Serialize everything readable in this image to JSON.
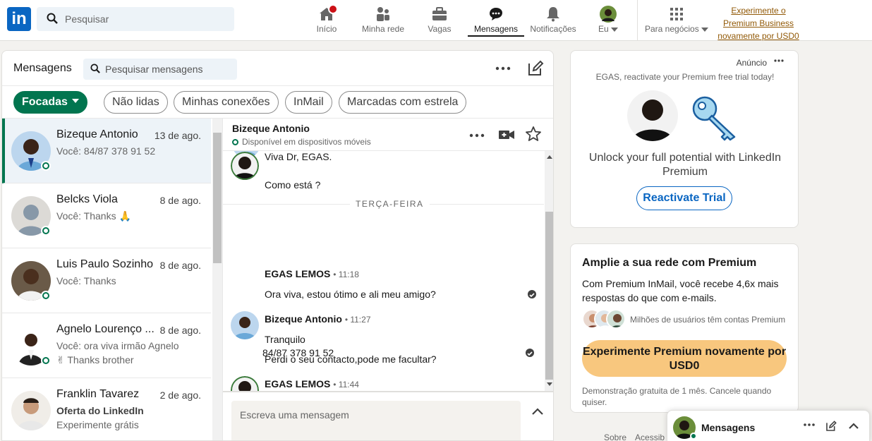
{
  "nav": {
    "logo": "in",
    "search_placeholder": "Pesquisar",
    "items": [
      {
        "label": "Início",
        "icon": "home-icon"
      },
      {
        "label": "Minha rede",
        "icon": "network-icon"
      },
      {
        "label": "Vagas",
        "icon": "briefcase-icon"
      },
      {
        "label": "Mensagens",
        "icon": "messaging-icon",
        "active": true
      },
      {
        "label": "Notificações",
        "icon": "bell-icon"
      },
      {
        "label": "Eu",
        "icon": "me-avatar"
      },
      {
        "label": "Para negócios",
        "icon": "grid-icon"
      }
    ],
    "premium_link": "Experimente o Premium Business novamente por USD0"
  },
  "messaging": {
    "title": "Mensagens",
    "search_placeholder": "Pesquisar mensagens",
    "filters": [
      "Focadas",
      "Não lidas",
      "Minhas conexões",
      "InMail",
      "Marcadas com estrela"
    ],
    "conversations": [
      {
        "name": "Bizeque Antonio",
        "date": "13 de ago.",
        "snippet": "Você: 84/87 378 91 52",
        "snippet2": ""
      },
      {
        "name": "Belcks Viola",
        "date": "8 de ago.",
        "snippet": "Você: Thanks 🙏",
        "snippet2": ""
      },
      {
        "name": "Luis Paulo Sozinho",
        "date": "8 de ago.",
        "snippet": "Você: Thanks",
        "snippet2": ""
      },
      {
        "name": "Agnelo Lourenço ...",
        "date": "8 de ago.",
        "snippet": "Você: ora viva irmão Agnelo",
        "snippet2": "✌ Thanks brother"
      },
      {
        "name": "Franklin Tavarez",
        "date": "2 de ago.",
        "snippet": "Oferta do LinkedIn",
        "snippet2": "Experimente grátis"
      }
    ]
  },
  "thread": {
    "name": "Bizeque Antonio",
    "status": "Disponível em dispositivos móveis",
    "prev_lines": [
      "Viva Dr, EGAS.",
      "Como está ?"
    ],
    "day_divider": "TERÇA-FEIRA",
    "messages": [
      {
        "sender": "EGAS LEMOS",
        "time": "• 11:18",
        "lines": [
          "Ora viva, estou ótimo e ali meu amigo?"
        ]
      },
      {
        "sender": "Bizeque Antonio",
        "time": "• 11:27",
        "lines": [
          "Tranquilo",
          "Perdi o seu contacto,pode me facultar?"
        ]
      },
      {
        "sender": "EGAS LEMOS",
        "time": "• 11:44",
        "lines": [
          "84/87 378 91 52"
        ]
      }
    ],
    "compose_placeholder": "Escreva uma mensagem"
  },
  "ad": {
    "label": "Anúncio",
    "line": "EGAS, reactivate your Premium free trial today!",
    "text": "Unlock your full potential with LinkedIn Premium",
    "button": "Reactivate Trial"
  },
  "premium": {
    "title": "Amplie a sua rede com Premium",
    "text": "Com Premium InMail, você recebe 4,6x mais respostas do que com e-mails.",
    "users": "Milhões de usuários têm contas Premium",
    "button": "Experimente Premium novamente por USD0",
    "footnote": "Demonstração gratuita de 1 mês. Cancele quando quiser."
  },
  "footer": {
    "links": [
      "Sobre",
      "Acessib"
    ]
  },
  "dock": {
    "title": "Mensagens"
  },
  "colors": {
    "brand": "#0a66c2",
    "green": "#01754f",
    "premium": "#f8c77e"
  }
}
